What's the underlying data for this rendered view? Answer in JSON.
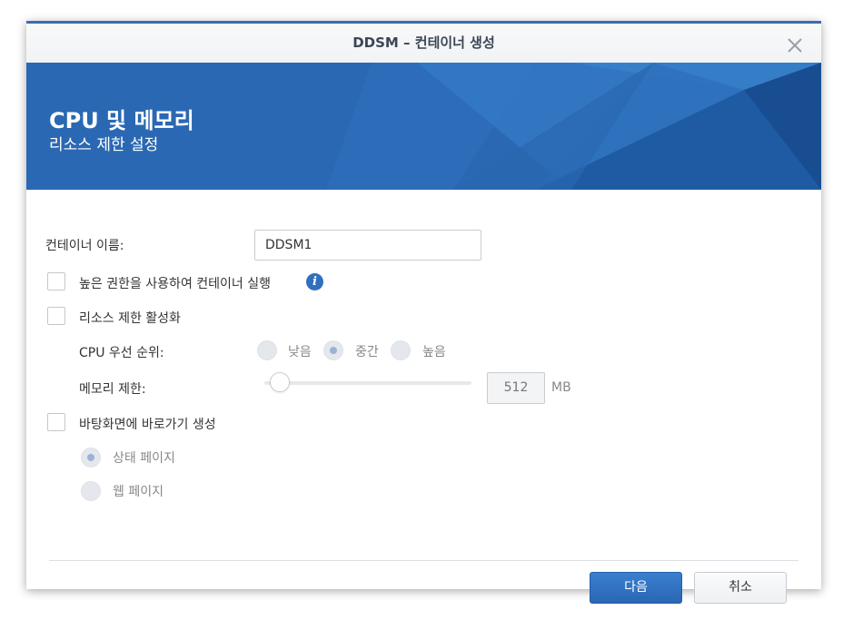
{
  "window": {
    "title": "DDSM – 컨테이너 생성"
  },
  "banner": {
    "title": "CPU 및 메모리",
    "subtitle": "리소스 제한 설정"
  },
  "form": {
    "container_name_label": "컨테이너 이름:",
    "container_name_value": "DDSM1",
    "privileged_label": "높은 권한을 사용하여 컨테이너 실행",
    "resource_limit_label": "리소스 제한 활성화",
    "cpu_priority_label": "CPU 우선 순위:",
    "cpu_options": [
      "낮음",
      "중간",
      "높음"
    ],
    "cpu_selected": "중간",
    "memory_limit_label": "메모리 제한:",
    "memory_value": "512",
    "memory_unit": "MB",
    "memory_slider_fraction": 0.0,
    "shortcut_label": "바탕화면에 바로가기 생성",
    "shortcut_options": [
      "상태 페이지",
      "웹 페이지"
    ],
    "shortcut_selected": "상태 페이지"
  },
  "footer": {
    "next_label": "다음",
    "cancel_label": "취소"
  },
  "colors": {
    "accent": "#2a68b3",
    "info_icon": "#2f6fbe"
  },
  "icons": {
    "close": "close-icon",
    "info": "info-icon"
  }
}
